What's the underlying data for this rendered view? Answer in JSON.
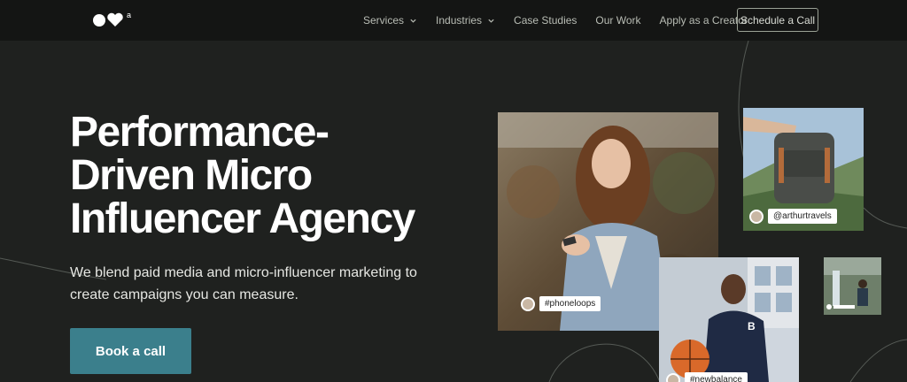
{
  "header": {
    "nav": [
      {
        "label": "Services",
        "dropdown": true
      },
      {
        "label": "Industries",
        "dropdown": true
      },
      {
        "label": "Case Studies",
        "dropdown": false
      },
      {
        "label": "Our Work",
        "dropdown": false
      },
      {
        "label": "Apply as a Creator",
        "dropdown": false
      }
    ],
    "cta_label": "Schedule a Call",
    "logo_mark": "a"
  },
  "hero": {
    "title_line1": "Performance-",
    "title_line2": "Driven Micro",
    "title_line3": "Influencer Agency",
    "subtitle_line1": "We blend paid media and micro-influencer marketing to",
    "subtitle_line2": "create campaigns you can measure.",
    "button_label": "Book a call"
  },
  "photos": {
    "main_tag": "#phoneloops",
    "backpack_tag": "@arthurtravels",
    "basketball_tag": "#newbalance"
  },
  "colors": {
    "background": "#1f211f",
    "header": "#141514",
    "accent": "#3b7f8c"
  }
}
